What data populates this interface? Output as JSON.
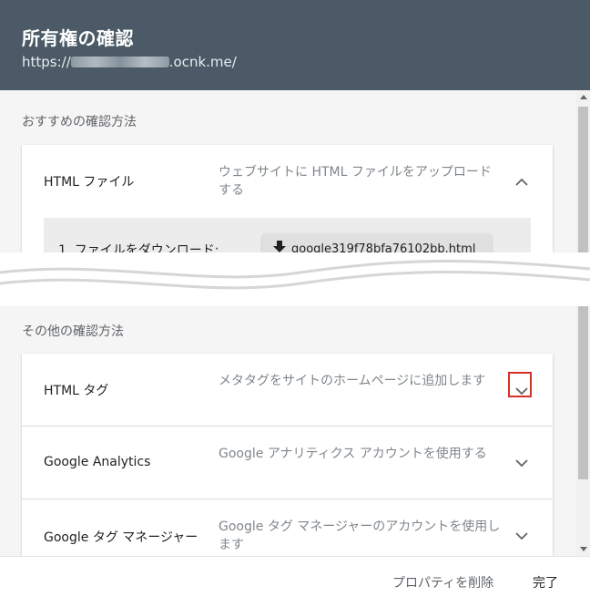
{
  "header": {
    "title": "所有権の確認",
    "url_prefix": "https://",
    "url_suffix": ".ocnk.me/"
  },
  "recommended": {
    "label": "おすすめの確認方法",
    "method": {
      "name": "HTML ファイル",
      "description": "ウェブサイトに HTML ファイルをアップロードする",
      "step_label": "1. ファイルをダウンロード:",
      "download_file": "google319f78bfa76102bb.html"
    }
  },
  "other": {
    "label": "その他の確認方法",
    "methods": [
      {
        "name": "HTML タグ",
        "description": "メタタグをサイトのホームページに追加します"
      },
      {
        "name": "Google Analytics",
        "description": "Google アナリティクス アカウントを使用する"
      },
      {
        "name": "Google タグ マネージャー",
        "description": "Google タグ マネージャーのアカウントを使用します"
      }
    ]
  },
  "footer": {
    "delete_label": "プロパティを削除",
    "done_label": "完了"
  },
  "icons": {
    "expand_less": "chevron-up-icon",
    "expand_more": "chevron-down-icon",
    "download": "download-icon"
  },
  "colors": {
    "header_bg": "#4b5a66",
    "highlight": "#d93025"
  }
}
